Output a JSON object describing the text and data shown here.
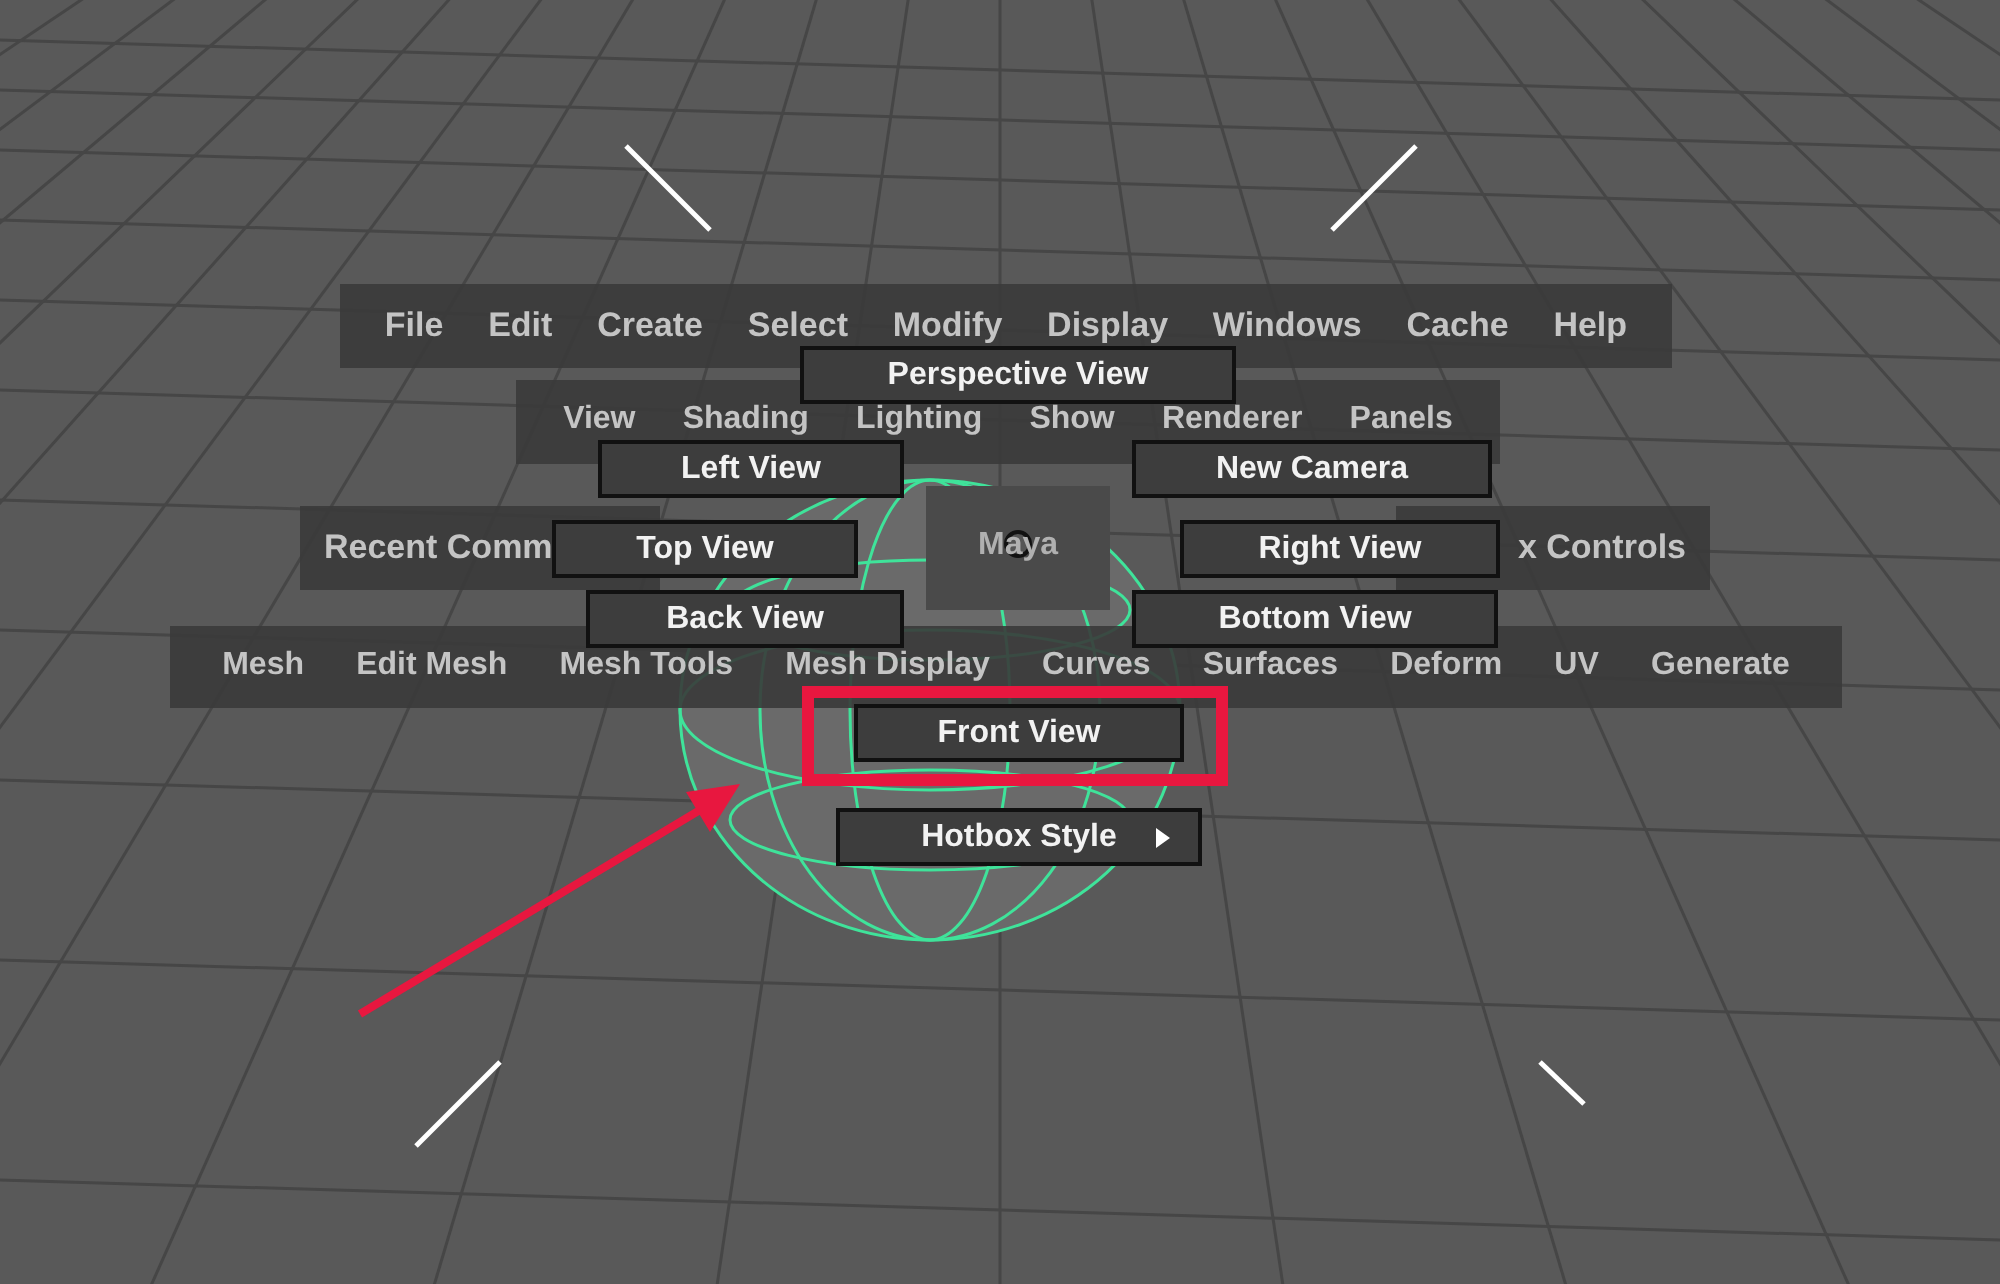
{
  "hotbox": {
    "menu_rows": [
      {
        "items": [
          "File",
          "Edit",
          "Create",
          "Select",
          "Modify",
          "Display",
          "Windows",
          "Cache",
          "Help"
        ]
      },
      {
        "items": [
          "View",
          "Shading",
          "Lighting",
          "Show",
          "Renderer",
          "Panels"
        ]
      },
      {
        "items": [
          "Mesh",
          "Edit Mesh",
          "Mesh Tools",
          "Mesh Display",
          "Curves",
          "Surfaces",
          "Deform",
          "UV",
          "Generate"
        ]
      }
    ],
    "west_zone": "Recent Comm",
    "east_zone": "x Controls",
    "center_zone": "Maya"
  },
  "marking_menu": [
    {
      "label": "Perspective View",
      "highlighted": false,
      "has_submenu": false
    },
    {
      "label": "Left View",
      "highlighted": false,
      "has_submenu": false
    },
    {
      "label": "New Camera",
      "highlighted": false,
      "has_submenu": false
    },
    {
      "label": "Top View",
      "highlighted": false,
      "has_submenu": false
    },
    {
      "label": "Right View",
      "highlighted": false,
      "has_submenu": false
    },
    {
      "label": "Back View",
      "highlighted": false,
      "has_submenu": false
    },
    {
      "label": "Bottom View",
      "highlighted": false,
      "has_submenu": false
    },
    {
      "label": "Front View",
      "highlighted": true,
      "has_submenu": false
    },
    {
      "label": "Hotbox Style",
      "highlighted": false,
      "has_submenu": true
    }
  ]
}
